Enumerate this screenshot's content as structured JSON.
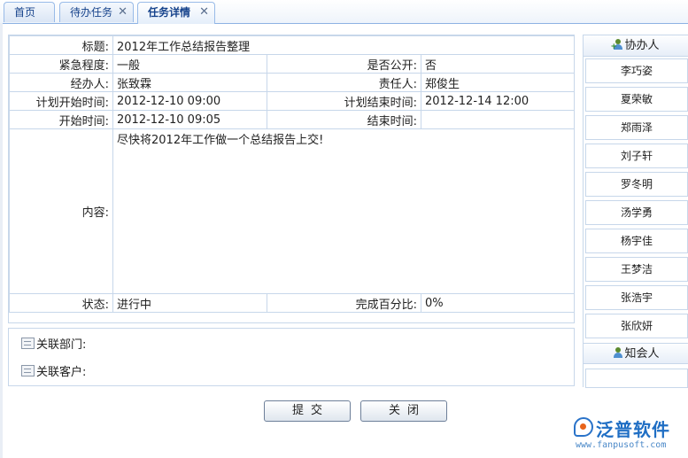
{
  "tabs": [
    {
      "label": "首页",
      "closable": false,
      "active": false
    },
    {
      "label": "待办任务",
      "closable": true,
      "active": false
    },
    {
      "label": "任务详情",
      "closable": true,
      "active": true
    }
  ],
  "form": {
    "title_label": "标题:",
    "title_value": "2012年工作总结报告整理",
    "urgency_label": "紧急程度:",
    "urgency_value": "一般",
    "public_label": "是否公开:",
    "public_value": "否",
    "handler_label": "经办人:",
    "handler_value": "张致霖",
    "owner_label": "责任人:",
    "owner_value": "郑俊生",
    "plan_start_label": "计划开始时间:",
    "plan_start_value": "2012-12-10 09:00",
    "plan_end_label": "计划结束时间:",
    "plan_end_value": "2012-12-14 12:00",
    "start_label": "开始时间:",
    "start_value": "2012-12-10 09:05",
    "end_label": "结束时间:",
    "end_value": "",
    "content_label": "内容:",
    "content_value": "尽快将2012年工作做一个总结报告上交!",
    "status_label": "状态:",
    "status_value": "进行中",
    "percent_label": "完成百分比:",
    "percent_value": "0%"
  },
  "related": {
    "dept_label": "关联部门:",
    "customer_label": "关联客户:"
  },
  "buttons": {
    "submit": "提交",
    "close": "关闭"
  },
  "sidebar": {
    "assist_title": "协办人",
    "assistants": [
      "李巧姿",
      "夏荣敏",
      "郑雨泽",
      "刘子轩",
      "罗冬明",
      "汤学勇",
      "杨宇佳",
      "王梦洁",
      "张浩宇",
      "张欣妍"
    ],
    "notify_title": "知会人"
  },
  "logo": {
    "name": "泛普软件",
    "url": "www.fanpusoft.com"
  },
  "colors": {
    "border": "#c7d7ea",
    "tab_text": "#15428b",
    "logo_blue": "#1f6ec4",
    "logo_orange": "#e8631a"
  }
}
